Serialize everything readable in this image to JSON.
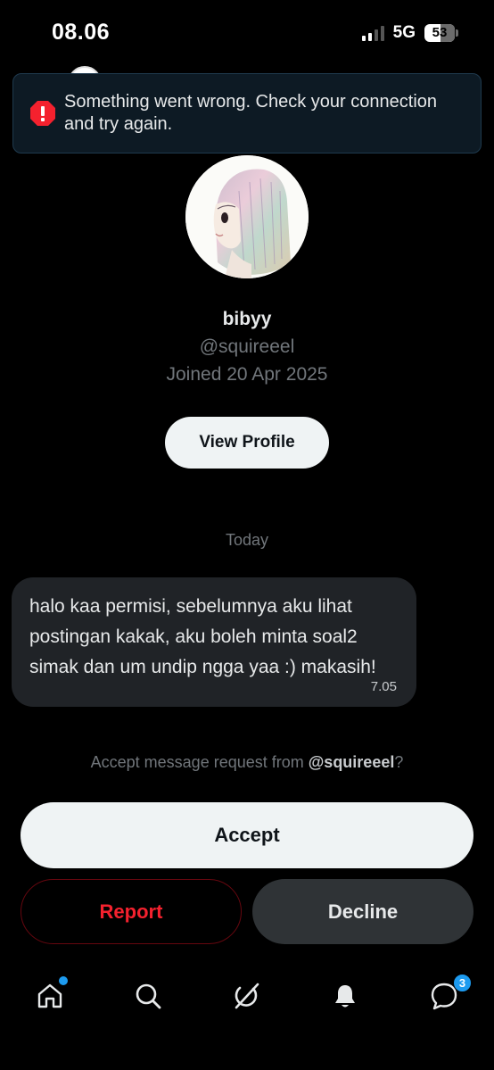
{
  "status_bar": {
    "time": "08.06",
    "network": "5G",
    "battery": "53"
  },
  "error_banner": {
    "icon": "error-octagon-icon",
    "message": "Something went wrong. Check your connection and try again."
  },
  "profile": {
    "avatar": "user-avatar-illustration",
    "name": "bibyy",
    "handle": "@squireeel",
    "joined": "Joined 20 Apr 2025",
    "view_profile_label": "View Profile"
  },
  "conversation": {
    "date_separator": "Today",
    "messages": [
      {
        "text": "halo kaa permisi, sebelumnya aku lihat postingan kakak, aku boleh minta soal2 simak dan um undip ngga yaa :) makasih!",
        "time": "7.05"
      }
    ]
  },
  "request": {
    "prompt_prefix": "Accept message request from ",
    "prompt_handle": "@squireeel",
    "prompt_suffix": "?",
    "accept_label": "Accept",
    "report_label": "Report",
    "decline_label": "Decline"
  },
  "bottom_nav": {
    "items": [
      {
        "icon": "home-icon",
        "has_dot": true
      },
      {
        "icon": "search-icon"
      },
      {
        "icon": "grok-icon"
      },
      {
        "icon": "bell-icon"
      },
      {
        "icon": "messages-icon",
        "badge": "3"
      }
    ]
  },
  "colors": {
    "background": "#000000",
    "banner_bg": "#0d1a24",
    "error_red": "#f4212e",
    "accent_blue": "#1d9bf0",
    "bubble_bg": "#202327",
    "muted_text": "#71767b"
  }
}
